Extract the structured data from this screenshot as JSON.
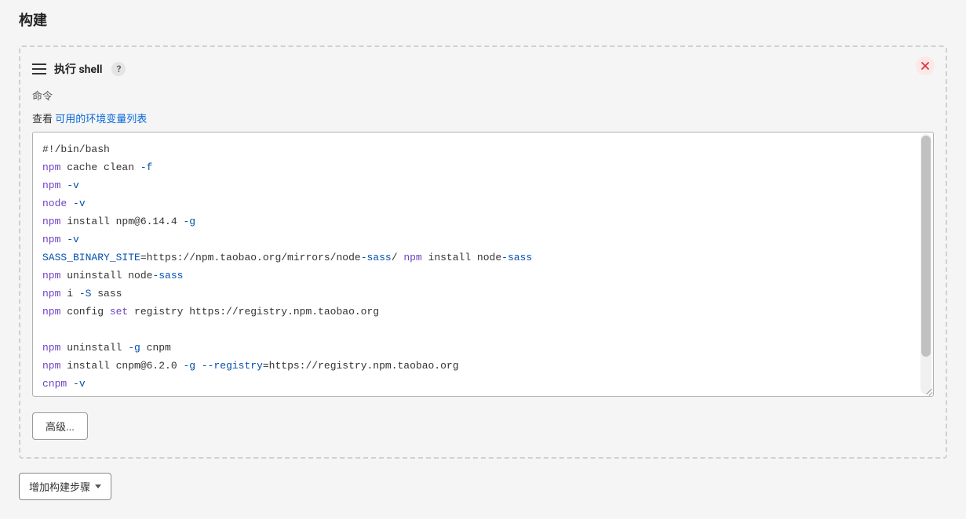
{
  "section": {
    "title": "构建"
  },
  "step": {
    "title": "执行 shell",
    "help_symbol": "?",
    "command_label": "命令",
    "hint_prefix": "查看 ",
    "hint_link": "可用的环境变量列表",
    "advanced_btn": "高级...",
    "code_tokens": [
      [
        {
          "t": "#!/bin/bash",
          "c": "str"
        }
      ],
      [
        {
          "t": "npm",
          "c": "kw"
        },
        {
          "t": " cache clean ",
          "c": "str"
        },
        {
          "t": "-f",
          "c": "opt"
        }
      ],
      [
        {
          "t": "npm",
          "c": "kw"
        },
        {
          "t": " ",
          "c": "str"
        },
        {
          "t": "-v",
          "c": "opt"
        }
      ],
      [
        {
          "t": "node",
          "c": "kw"
        },
        {
          "t": " ",
          "c": "str"
        },
        {
          "t": "-v",
          "c": "opt"
        }
      ],
      [
        {
          "t": "npm",
          "c": "kw"
        },
        {
          "t": " install npm@6.14.4 ",
          "c": "str"
        },
        {
          "t": "-g",
          "c": "opt"
        }
      ],
      [
        {
          "t": "npm",
          "c": "kw"
        },
        {
          "t": " ",
          "c": "str"
        },
        {
          "t": "-v",
          "c": "opt"
        }
      ],
      [
        {
          "t": "SASS_BINARY_SITE",
          "c": "opt"
        },
        {
          "t": "=https://npm.taobao.org/mirrors/node",
          "c": "str"
        },
        {
          "t": "-sass",
          "c": "opt"
        },
        {
          "t": "/ ",
          "c": "str"
        },
        {
          "t": "npm",
          "c": "kw"
        },
        {
          "t": " install node",
          "c": "str"
        },
        {
          "t": "-sass",
          "c": "opt"
        }
      ],
      [
        {
          "t": "npm",
          "c": "kw"
        },
        {
          "t": " uninstall node",
          "c": "str"
        },
        {
          "t": "-sass",
          "c": "opt"
        }
      ],
      [
        {
          "t": "npm",
          "c": "kw"
        },
        {
          "t": " i ",
          "c": "str"
        },
        {
          "t": "-S",
          "c": "opt"
        },
        {
          "t": " sass",
          "c": "str"
        }
      ],
      [
        {
          "t": "npm",
          "c": "kw"
        },
        {
          "t": " config ",
          "c": "str"
        },
        {
          "t": "set",
          "c": "kw"
        },
        {
          "t": " registry https://registry.npm.taobao.org",
          "c": "str"
        }
      ],
      [],
      [
        {
          "t": "npm",
          "c": "kw"
        },
        {
          "t": " uninstall ",
          "c": "str"
        },
        {
          "t": "-g",
          "c": "opt"
        },
        {
          "t": " cnpm",
          "c": "str"
        }
      ],
      [
        {
          "t": "npm",
          "c": "kw"
        },
        {
          "t": " install cnpm@6.2.0 ",
          "c": "str"
        },
        {
          "t": "-g",
          "c": "opt"
        },
        {
          "t": " ",
          "c": "str"
        },
        {
          "t": "--registry",
          "c": "opt"
        },
        {
          "t": "=https://registry.npm.taobao.org",
          "c": "str"
        }
      ],
      [
        {
          "t": "cnpm",
          "c": "kw"
        },
        {
          "t": " ",
          "c": "str"
        },
        {
          "t": "-v",
          "c": "opt"
        }
      ]
    ]
  },
  "footer": {
    "add_step_btn": "增加构建步骤"
  }
}
